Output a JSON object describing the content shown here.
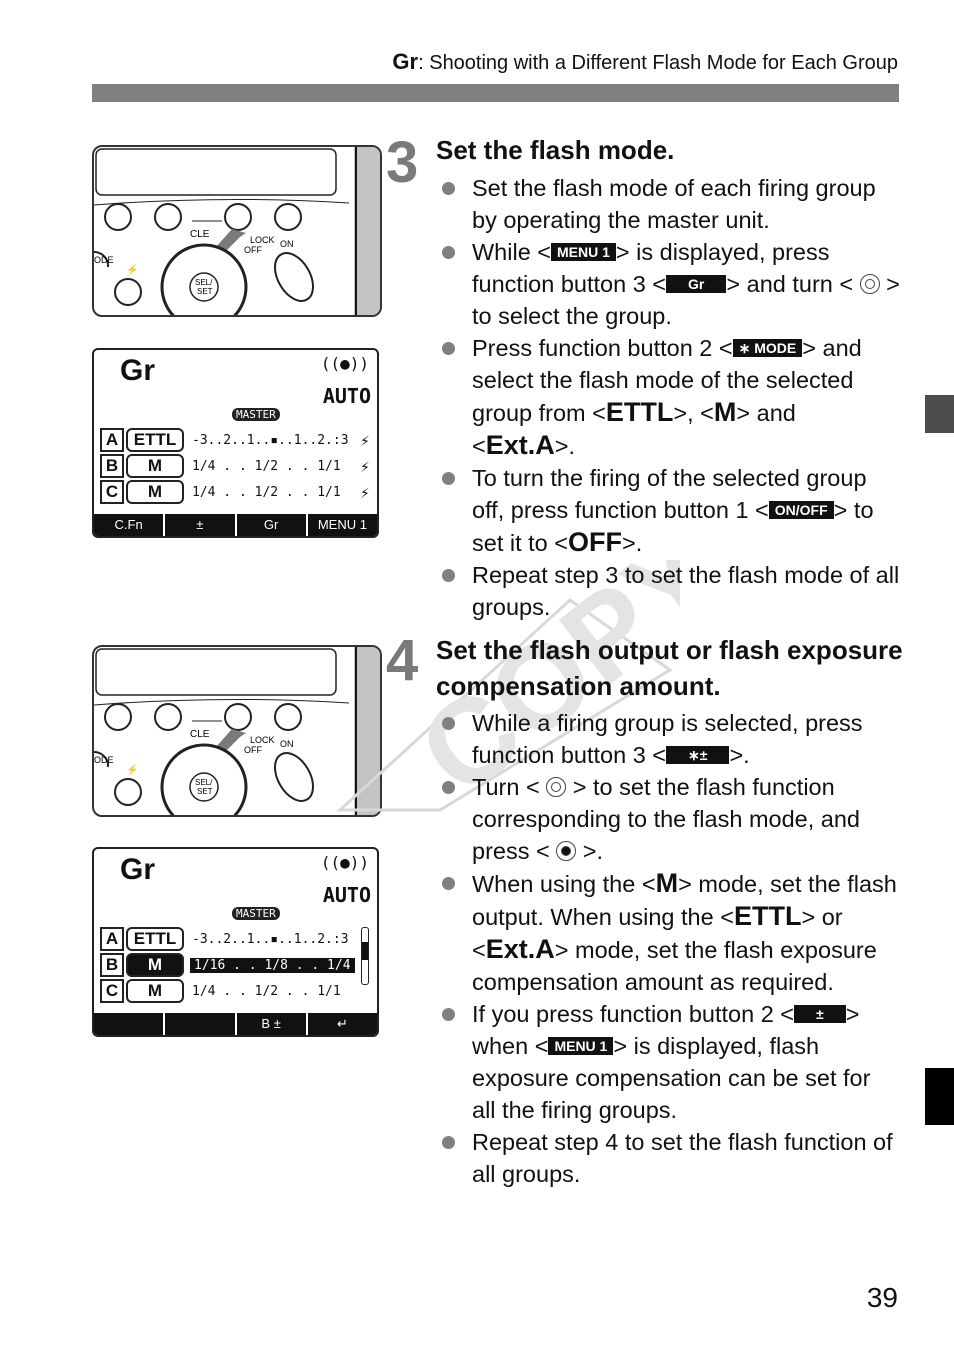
{
  "header": {
    "title_prefix": "Gr",
    "title_text": ": Shooting with a Different Flash Mode for Each Group"
  },
  "figures": {
    "panel_labels": {
      "clear": "CLEAR",
      "lock": "LOCK",
      "off": "OFF",
      "on": "ON",
      "mode": "MODE",
      "sel_set": "SEL/\nSET"
    },
    "lcd1": {
      "title": "Gr",
      "auto": "AUTO",
      "master": "MASTER",
      "rows": [
        {
          "group": "A",
          "mode": "ETTL",
          "scale": "-3..2..1..▪..1..2.:3",
          "selected": false
        },
        {
          "group": "B",
          "mode": "M",
          "scale": "1/4 . . 1/2 . . 1/1",
          "selected": false
        },
        {
          "group": "C",
          "mode": "M",
          "scale": "1/4 . . 1/2 . . 1/1",
          "selected": false
        }
      ],
      "softkeys": [
        "C.Fn",
        "±",
        "Gr",
        "MENU 1"
      ]
    },
    "lcd2": {
      "title": "Gr",
      "auto": "AUTO",
      "master": "MASTER",
      "rows": [
        {
          "group": "A",
          "mode": "ETTL",
          "scale": "-3..2..1..▪..1..2.:3",
          "selected": false
        },
        {
          "group": "B",
          "mode": "M",
          "scale": "1/16 . . 1/8 . . 1/4",
          "selected": true
        },
        {
          "group": "C",
          "mode": "M",
          "scale": "1/4 . . 1/2 . . 1/1",
          "selected": false
        }
      ],
      "softkeys": [
        "",
        "",
        "B ±",
        "↵"
      ]
    }
  },
  "step3": {
    "number": "3",
    "title": "Set the flash mode.",
    "bullets": [
      {
        "text": "Set the flash mode of each firing group by operating the master unit."
      },
      {
        "pre": "While <",
        "key1": "MENU 1",
        "mid1": "> is displayed, press function button 3 <",
        "key2": "Gr",
        "mid2": "> and turn < ",
        "post": " > to select the group."
      },
      {
        "pre": "Press function button 2 <",
        "key1": "∗ MODE",
        "mid1": "> and select the flash mode of the selected group from <",
        "b1": "ETTL",
        "mid2": ">, <",
        "b2": "M",
        "mid3": "> and <",
        "b3": "Ext.A",
        "post": ">."
      },
      {
        "pre": "To turn the firing of the selected group off, press function button 1 <",
        "key1": "ON/OFF",
        "mid1": "> to set it to <",
        "b1": "OFF",
        "post": ">."
      },
      {
        "text": "Repeat step 3 to set the flash mode of all groups."
      }
    ]
  },
  "step4": {
    "number": "4",
    "title": "Set the flash output or flash exposure compensation amount.",
    "bullets": [
      {
        "pre": "While a firing group is selected, press function button 3 <",
        "key1": "∗±",
        "post": ">."
      },
      {
        "pre": "Turn < ",
        "mid1": " > to set the flash function corresponding to the flash mode, and press < ",
        "post": " >."
      },
      {
        "pre": "When using the <",
        "b1": "M",
        "mid1": "> mode, set the flash output. When using the <",
        "b2": "ETTL",
        "mid2": "> or <",
        "b3": "Ext.A",
        "post": "> mode, set the flash exposure compensation amount as required."
      },
      {
        "pre": "If you press function button 2 <",
        "key1": "±",
        "mid1": "> when <",
        "key2": "MENU 1",
        "post": "> is displayed, flash exposure compensation can be set for all the firing groups."
      },
      {
        "text": "Repeat step 4 to set the flash function of all groups."
      }
    ]
  },
  "watermark": "COPY",
  "page_number": "39",
  "colors": {
    "header_bar": "#808080",
    "step_number": "#7a7a7a",
    "side_tab_upper": "#4d4d4d",
    "side_tab_lower": "#000000",
    "bullet": "#808080"
  }
}
